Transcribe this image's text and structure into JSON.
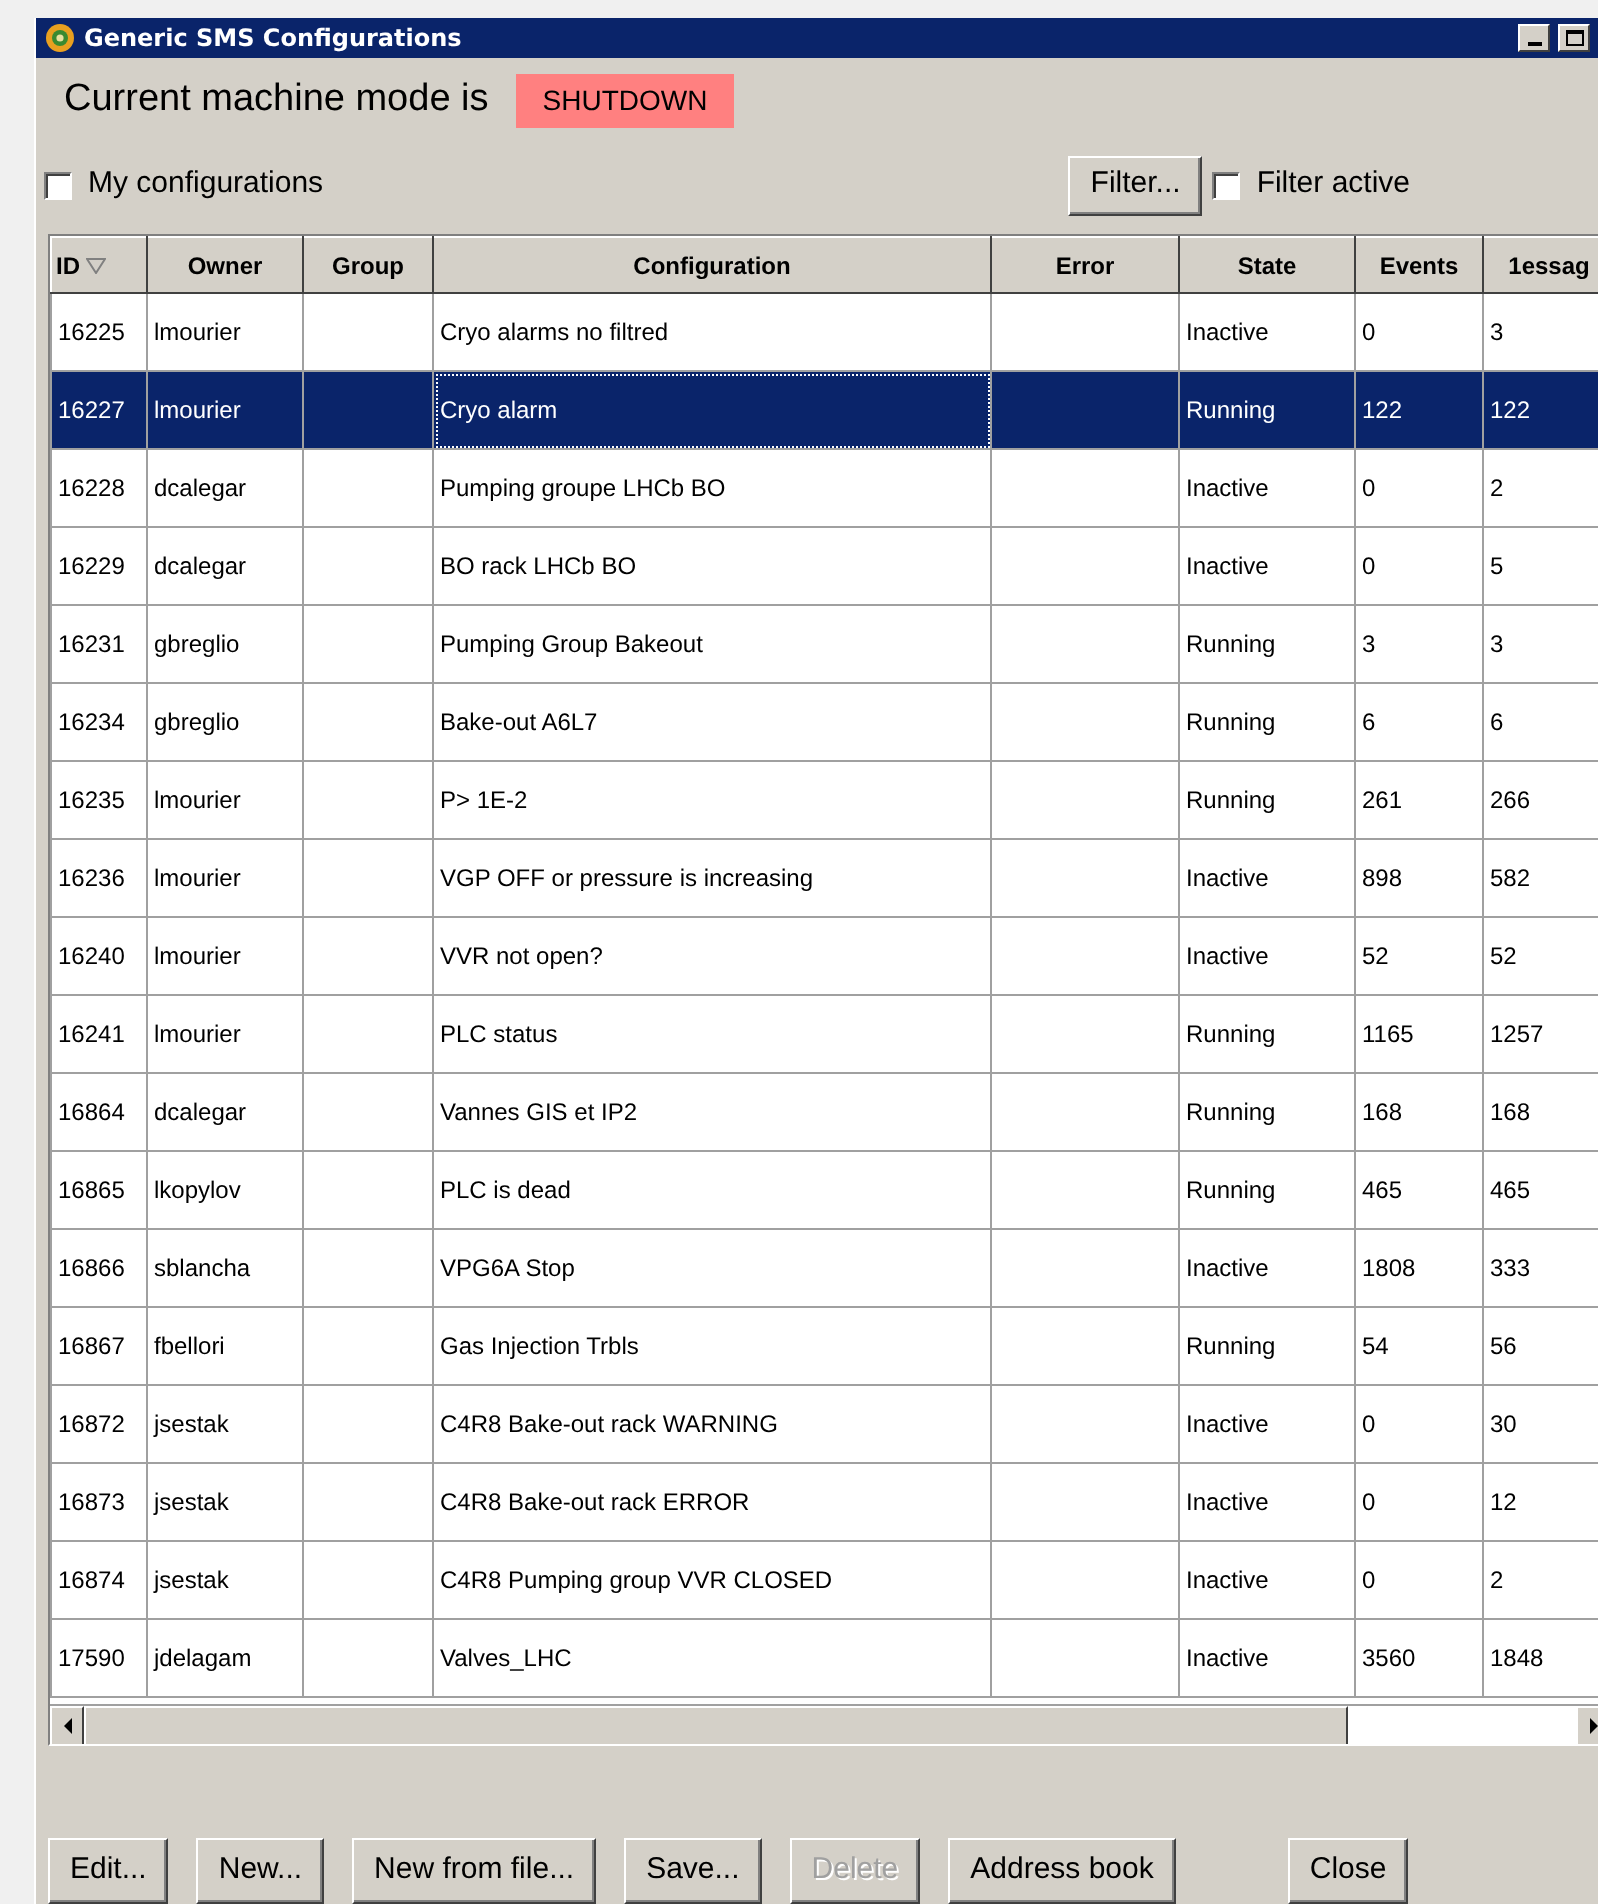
{
  "window": {
    "title": "Generic SMS Configurations"
  },
  "mode": {
    "label": "Current machine mode is",
    "value": "SHUTDOWN"
  },
  "my_configurations": {
    "label": "My configurations",
    "checked": false
  },
  "filter_button": "Filter...",
  "filter_active": {
    "label": "Filter active",
    "checked": false
  },
  "table": {
    "columns": [
      {
        "label": "ID",
        "sorted": true
      },
      {
        "label": "Owner",
        "sorted": false
      },
      {
        "label": "Group",
        "sorted": false
      },
      {
        "label": "Configuration",
        "sorted": false
      },
      {
        "label": "Error",
        "sorted": false
      },
      {
        "label": "State",
        "sorted": false
      },
      {
        "label": "Events",
        "sorted": false
      },
      {
        "label": "1essag",
        "sorted": false
      }
    ],
    "rows": [
      {
        "cells": [
          "16225",
          "lmourier",
          "",
          "Cryo alarms no filtred",
          "",
          "Inactive",
          "0",
          "3"
        ],
        "selected": false
      },
      {
        "cells": [
          "16227",
          "lmourier",
          "",
          "Cryo alarm",
          "",
          "Running",
          "122",
          "122"
        ],
        "selected": true
      },
      {
        "cells": [
          "16228",
          "dcalegar",
          "",
          "Pumping groupe LHCb BO",
          "",
          "Inactive",
          "0",
          "2"
        ],
        "selected": false
      },
      {
        "cells": [
          "16229",
          "dcalegar",
          "",
          "BO rack LHCb BO",
          "",
          "Inactive",
          "0",
          "5"
        ],
        "selected": false
      },
      {
        "cells": [
          "16231",
          "gbreglio",
          "",
          "Pumping Group Bakeout",
          "",
          "Running",
          "3",
          "3"
        ],
        "selected": false
      },
      {
        "cells": [
          "16234",
          "gbreglio",
          "",
          "Bake-out A6L7",
          "",
          "Running",
          "6",
          "6"
        ],
        "selected": false
      },
      {
        "cells": [
          "16235",
          "lmourier",
          "",
          "P> 1E-2",
          "",
          "Running",
          "261",
          "266"
        ],
        "selected": false
      },
      {
        "cells": [
          "16236",
          "lmourier",
          "",
          "VGP OFF or pressure is increasing",
          "",
          "Inactive",
          "898",
          "582"
        ],
        "selected": false
      },
      {
        "cells": [
          "16240",
          "lmourier",
          "",
          "VVR not open?",
          "",
          "Inactive",
          "52",
          "52"
        ],
        "selected": false
      },
      {
        "cells": [
          "16241",
          "lmourier",
          "",
          "PLC status",
          "",
          "Running",
          "1165",
          "1257"
        ],
        "selected": false
      },
      {
        "cells": [
          "16864",
          "dcalegar",
          "",
          "Vannes GIS et IP2",
          "",
          "Running",
          "168",
          "168"
        ],
        "selected": false
      },
      {
        "cells": [
          "16865",
          "lkopylov",
          "",
          "PLC is dead",
          "",
          "Running",
          "465",
          "465"
        ],
        "selected": false
      },
      {
        "cells": [
          "16866",
          "sblancha",
          "",
          "VPG6A Stop",
          "",
          "Inactive",
          "1808",
          "333"
        ],
        "selected": false
      },
      {
        "cells": [
          "16867",
          "fbellori",
          "",
          "Gas Injection Trbls",
          "",
          "Running",
          "54",
          "56"
        ],
        "selected": false
      },
      {
        "cells": [
          "16872",
          "jsestak",
          "",
          "C4R8 Bake-out rack WARNING",
          "",
          "Inactive",
          "0",
          "30"
        ],
        "selected": false
      },
      {
        "cells": [
          "16873",
          "jsestak",
          "",
          "C4R8 Bake-out rack ERROR",
          "",
          "Inactive",
          "0",
          "12"
        ],
        "selected": false
      },
      {
        "cells": [
          "16874",
          "jsestak",
          "",
          "C4R8 Pumping group VVR CLOSED",
          "",
          "Inactive",
          "0",
          "2"
        ],
        "selected": false
      },
      {
        "cells": [
          "17590",
          "jdelagam",
          "",
          "Valves_LHC",
          "",
          "Inactive",
          "3560",
          "1848"
        ],
        "selected": false
      }
    ]
  },
  "buttons": [
    {
      "label": "Edit...",
      "disabled": false
    },
    {
      "label": "New...",
      "disabled": false
    },
    {
      "label": "New from file...",
      "disabled": false
    },
    {
      "label": "Save...",
      "disabled": false
    },
    {
      "label": "Delete",
      "disabled": true
    },
    {
      "label": "Address book",
      "disabled": false
    },
    {
      "label": "Close",
      "disabled": false
    }
  ]
}
